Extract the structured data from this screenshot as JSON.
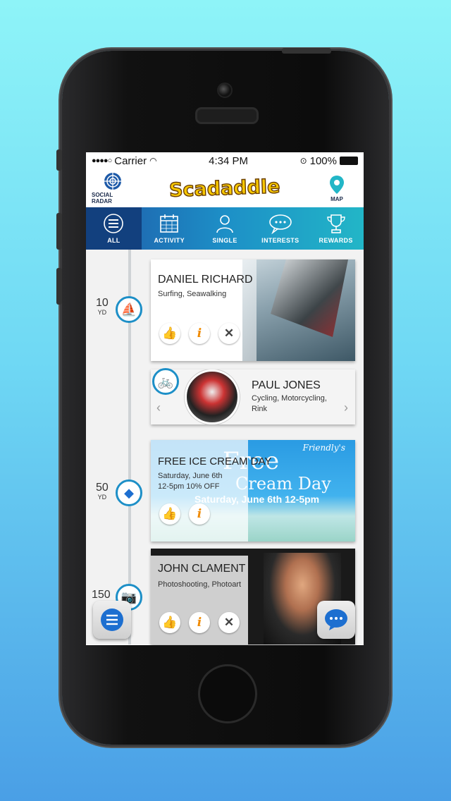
{
  "status": {
    "carrier": "Carrier",
    "time": "4:34 PM",
    "battery": "100%"
  },
  "header": {
    "left_label": "SOCIAL RADAR",
    "logo": "Scadaddle",
    "right_label": "MAP"
  },
  "tabs": [
    {
      "label": "ALL",
      "icon": "menu-icon"
    },
    {
      "label": "ACTIVITY",
      "icon": "calendar-icon"
    },
    {
      "label": "SINGLE",
      "icon": "person-icon"
    },
    {
      "label": "INTERESTS",
      "icon": "chat-bubble-icon"
    },
    {
      "label": "REWARDS",
      "icon": "trophy-icon"
    }
  ],
  "feed": [
    {
      "distance": "10",
      "unit": "YD",
      "name": "DANIEL RICHARD",
      "sub": "Surfing, Seawalking"
    },
    {
      "name": "PAUL JONES",
      "sub1": "Cycling, Motorcycling,",
      "sub2": "Rink"
    },
    {
      "distance": "50",
      "unit": "YD",
      "name": "FREE ICE CREAM DAY",
      "sub1": "Saturday, June 6th",
      "sub2": "12-5pm 10% OFF",
      "banner_brand": "Friendly's",
      "banner_title1": "Free",
      "banner_title2": "Cream Day",
      "banner_date": "Saturday, June 6th 12-5pm"
    },
    {
      "distance": "150",
      "name": "JOHN CLAMENT",
      "sub": "Photoshooting, Photoart"
    }
  ],
  "colors": {
    "accent": "#1d8fc7",
    "tab_active": "#12407e",
    "logo": "#f7c800"
  }
}
